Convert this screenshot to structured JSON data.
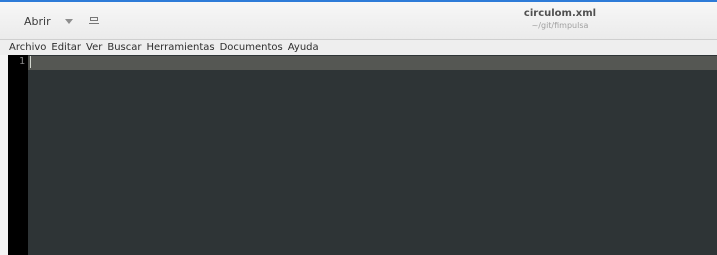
{
  "header": {
    "open_button_label": "Abrir",
    "title": "circulom.xml",
    "subtitle": "~/git/fimpulsa"
  },
  "menu": {
    "items": [
      {
        "label": "Archivo"
      },
      {
        "label": "Editar"
      },
      {
        "label": "Ver"
      },
      {
        "label": "Buscar"
      },
      {
        "label": "Herramientas"
      },
      {
        "label": "Documentos"
      },
      {
        "label": "Ayuda"
      }
    ]
  },
  "editor": {
    "line_numbers": [
      "1"
    ],
    "content": ""
  },
  "icons": {
    "dropdown": "chevron-down-icon",
    "pin": "pin-icon"
  },
  "colors": {
    "accent": "#2d7bd8",
    "editor_background": "#2e3436",
    "current_line": "#555753",
    "gutter": "#000000"
  }
}
